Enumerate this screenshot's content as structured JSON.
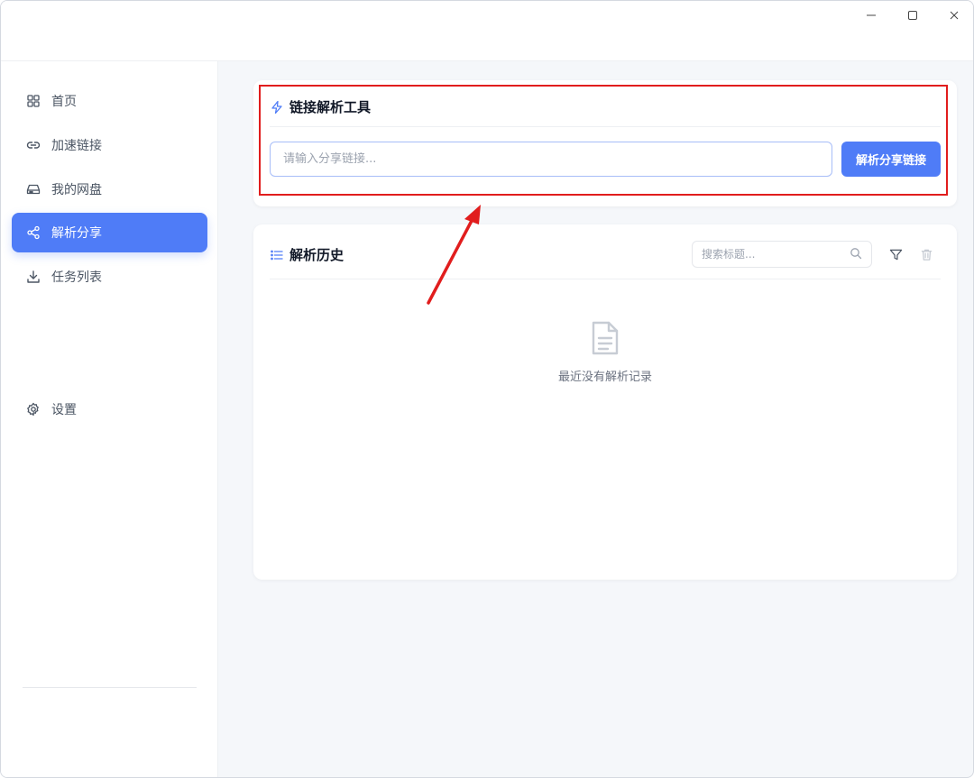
{
  "window": {
    "minimize_icon": "minimize-icon",
    "maximize_icon": "maximize-icon",
    "close_icon": "close-icon"
  },
  "sidebar": {
    "items": [
      {
        "label": "首页",
        "icon": "grid-icon"
      },
      {
        "label": "加速链接",
        "icon": "link-icon"
      },
      {
        "label": "我的网盘",
        "icon": "hard-drive-icon"
      },
      {
        "label": "解析分享",
        "icon": "share-icon",
        "active": true
      },
      {
        "label": "任务列表",
        "icon": "download-icon"
      }
    ],
    "settings_label": "设置"
  },
  "parse_card": {
    "title": "链接解析工具",
    "input_placeholder": "请输入分享链接...",
    "input_value": "",
    "button_label": "解析分享链接"
  },
  "history_card": {
    "title": "解析历史",
    "search_placeholder": "搜索标题...",
    "empty_text": "最近没有解析记录"
  },
  "colors": {
    "accent": "#4f7cf7",
    "annotation_red": "#e11d1d"
  }
}
